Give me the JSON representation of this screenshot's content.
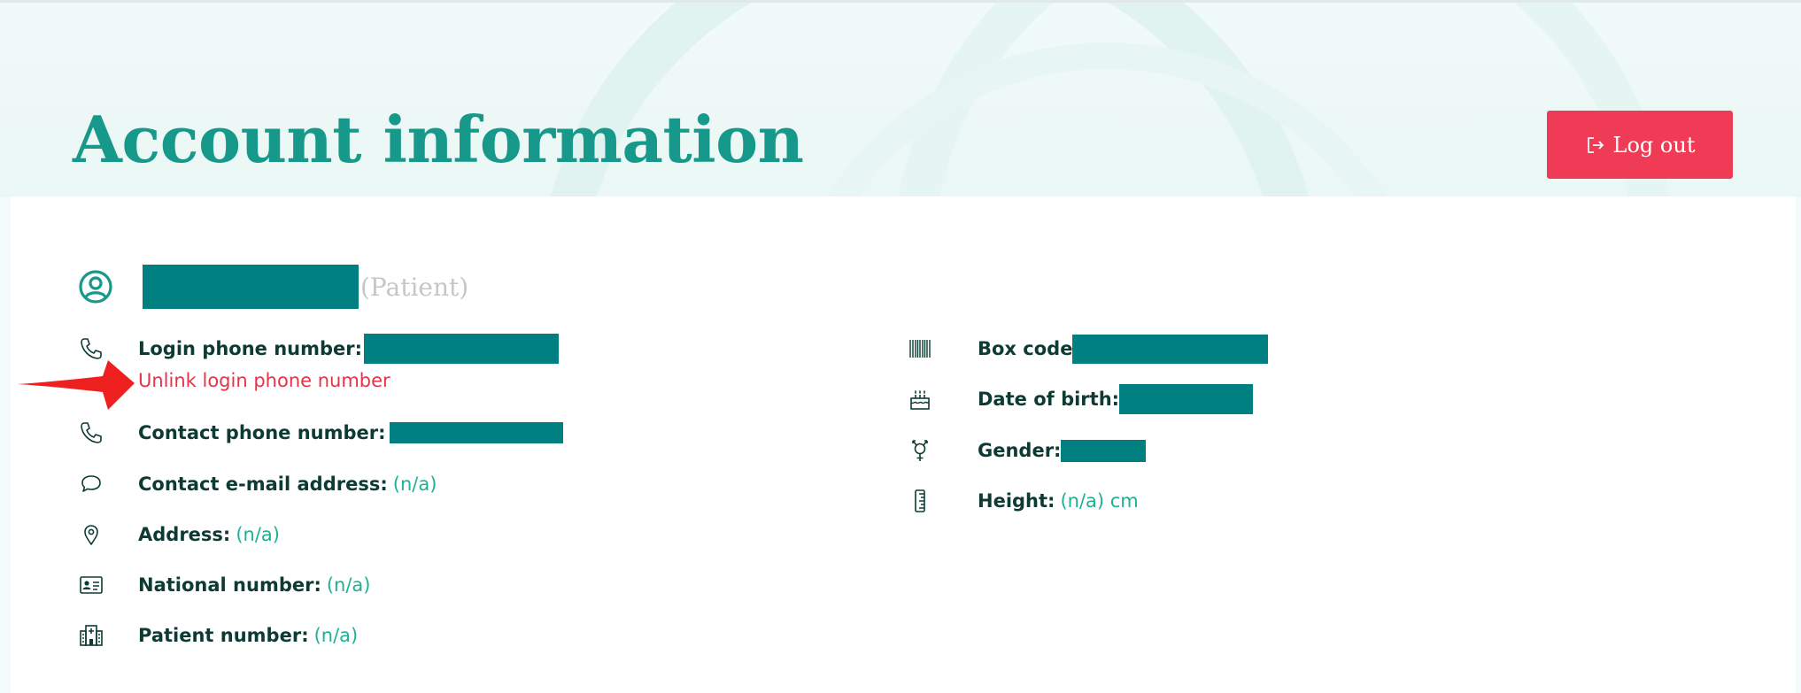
{
  "header": {
    "title": "Account information",
    "logout_label": "Log out"
  },
  "user": {
    "role": "(Patient)"
  },
  "left_fields": [
    {
      "label": "Login phone number:",
      "value": ""
    },
    {
      "label": "Contact phone number:",
      "value": ""
    },
    {
      "label": "Contact e-mail address:",
      "value": "(n/a)"
    },
    {
      "label": "Address:",
      "value": "(n/a)"
    },
    {
      "label": "National number:",
      "value": "(n/a)"
    },
    {
      "label": "Patient number:",
      "value": "(n/a)"
    }
  ],
  "unlink_label": "Unlink login phone number",
  "right_fields": [
    {
      "label": "Box code",
      "value": ""
    },
    {
      "label": "Date of birth:",
      "value": ""
    },
    {
      "label": "Gender:",
      "value": ""
    },
    {
      "label": "Height:",
      "value": "(n/a) cm"
    }
  ],
  "colors": {
    "accent": "#16998a",
    "value_text": "#1fb096",
    "label_text": "#0d3b34",
    "danger": "#ef3b55",
    "redaction": "#008080",
    "arrow": "#ee1f1f"
  },
  "icons": {
    "user": "user-circle-icon",
    "login_phone": "phone-icon",
    "contact_phone": "phone-icon",
    "email": "speech-bubble-icon",
    "address": "map-pin-icon",
    "national_number": "id-card-icon",
    "patient_number": "hospital-icon",
    "box_code": "barcode-icon",
    "dob": "birthday-cake-icon",
    "gender": "gender-icon",
    "height": "ruler-icon",
    "logout": "logout-icon",
    "annotation": "red-arrow-icon"
  }
}
